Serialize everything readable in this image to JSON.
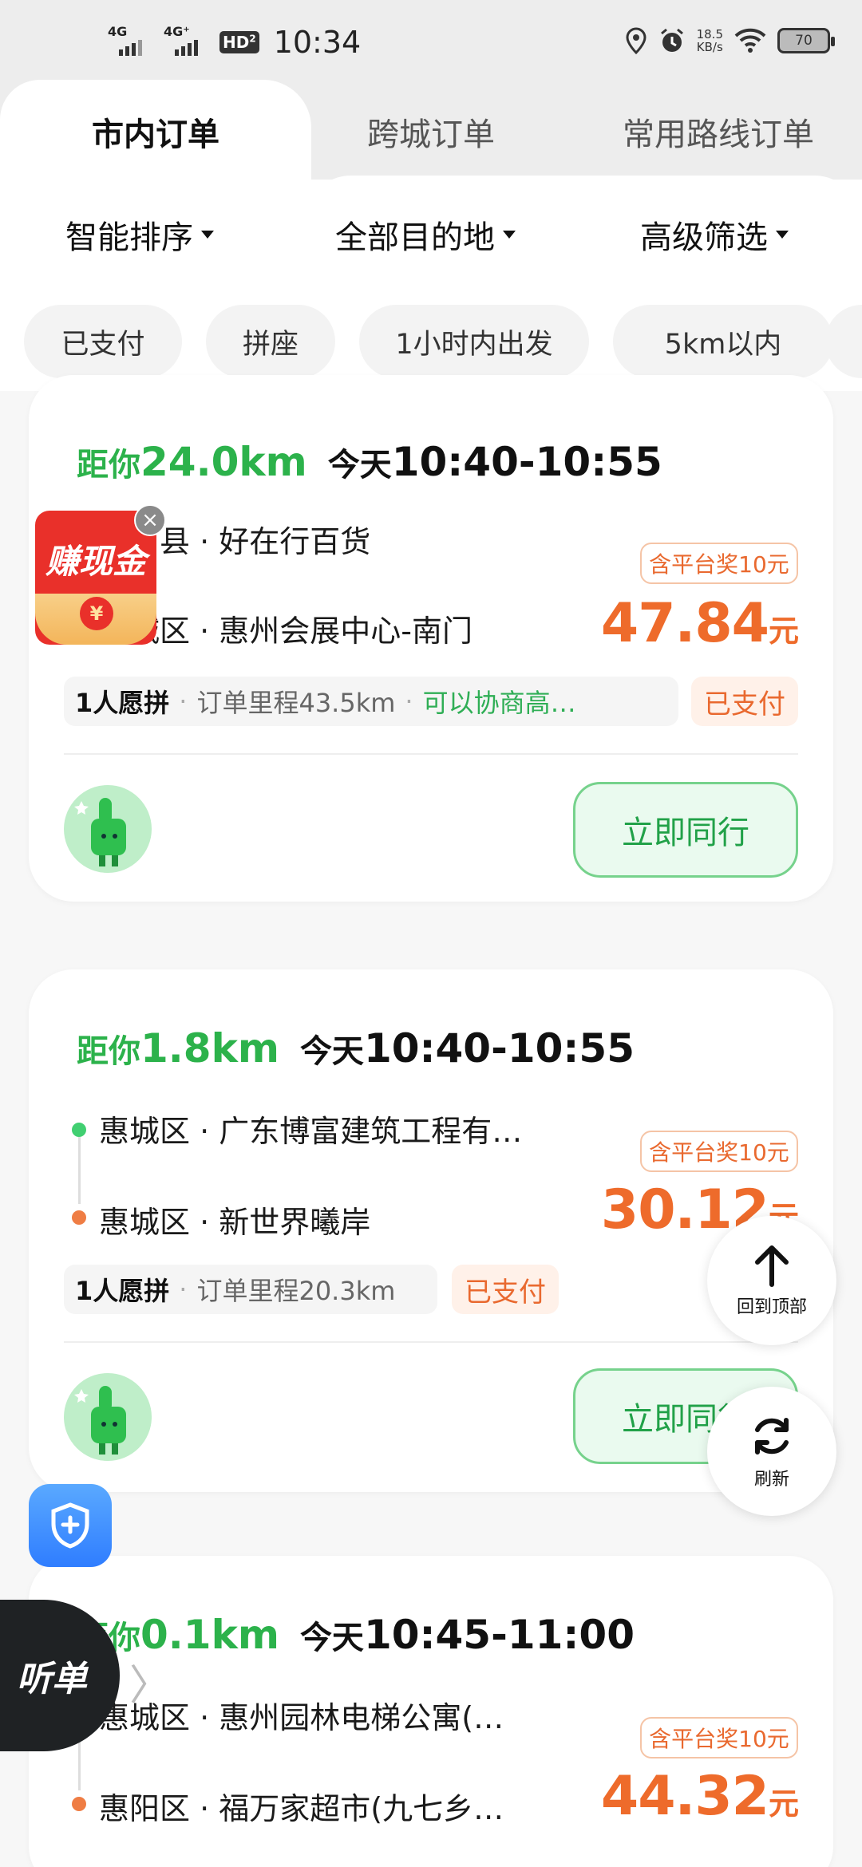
{
  "status_bar": {
    "time": "10:34",
    "net1": "4G",
    "net2": "4G⁺",
    "hd": "HD",
    "hd_sim": "2",
    "speed_value": "18.5",
    "speed_unit": "KB/s",
    "battery": "70"
  },
  "tabs": {
    "items": [
      "市内订单",
      "跨城订单",
      "常用路线订单"
    ],
    "active": 0
  },
  "filters": [
    "智能排序",
    "全部目的地",
    "高级筛选"
  ],
  "chips": [
    "已支付",
    "拼座",
    "1小时内出发",
    "5km以内"
  ],
  "orders": [
    {
      "dist_prefix": "距你",
      "dist_value": "24.0km",
      "day": "今天",
      "time_range": "10:40-10:55",
      "from": "博罗县 · 好在行百货",
      "to": "惠城区 · 惠州会展中心-南门",
      "bonus": "含平台奖10元",
      "price": "47.84",
      "price_unit": "元",
      "people": "1人愿拼",
      "mileage": "订单里程43.5km",
      "note": "可以协商高…",
      "paid": "已支付",
      "action": "立即同行"
    },
    {
      "dist_prefix": "距你",
      "dist_value": "1.8km",
      "day": "今天",
      "time_range": "10:40-10:55",
      "from": "惠城区 · 广东博富建筑工程有…",
      "to": "惠城区 · 新世界曦岸",
      "bonus": "含平台奖10元",
      "price": "30.12",
      "price_unit": "元",
      "people": "1人愿拼",
      "mileage": "订单里程20.3km",
      "paid": "已支付",
      "action": "立即同行"
    },
    {
      "dist_prefix": "距你",
      "dist_value": "0.1km",
      "day": "今天",
      "time_range": "10:45-11:00",
      "from": "惠城区 · 惠州园林电梯公寓(…",
      "to": "惠阳区 · 福万家超市(九七乡…",
      "bonus": "含平台奖10元",
      "price": "44.32",
      "price_unit": "元"
    }
  ],
  "floating": {
    "back_top": "回到顶部",
    "refresh": "刷新",
    "cash_badge": "赚现金",
    "listen": "听单"
  },
  "colors": {
    "accent_green": "#2cb24b",
    "price_orange": "#ee6b2b"
  }
}
